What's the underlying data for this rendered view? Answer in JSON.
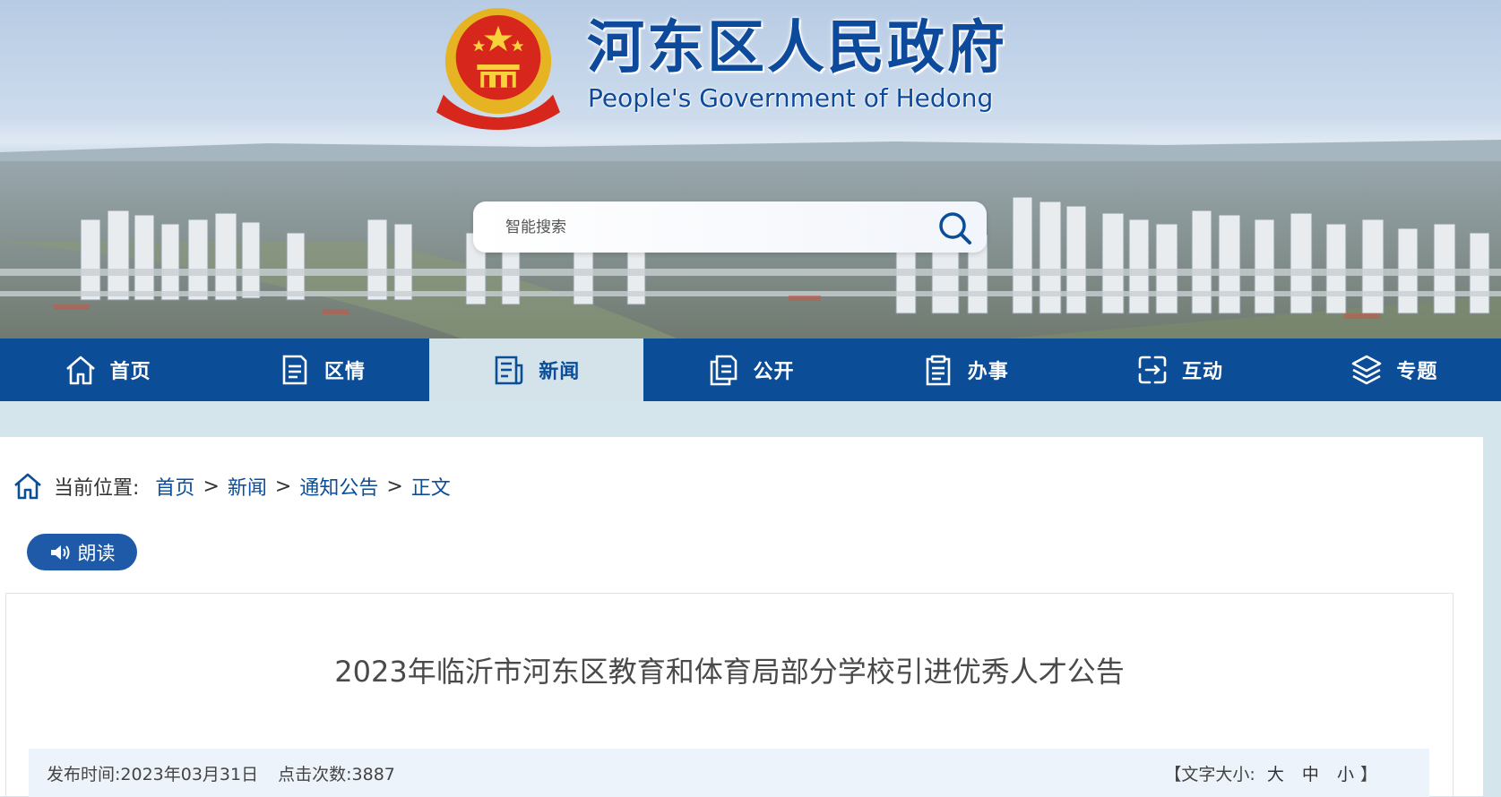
{
  "header": {
    "title": "河东区人民政府",
    "subtitle": "People's Government of Hedong"
  },
  "search": {
    "placeholder": "智能搜索",
    "icon": "search-icon"
  },
  "nav": {
    "items": [
      {
        "label": "首页",
        "icon": "home-icon"
      },
      {
        "label": "区情",
        "icon": "document-icon"
      },
      {
        "label": "新闻",
        "icon": "newspaper-icon",
        "active": true
      },
      {
        "label": "公开",
        "icon": "files-icon"
      },
      {
        "label": "办事",
        "icon": "clipboard-icon"
      },
      {
        "label": "互动",
        "icon": "interaction-icon"
      },
      {
        "label": "专题",
        "icon": "layers-icon"
      }
    ]
  },
  "breadcrumb": {
    "label": "当前位置:",
    "items": [
      "首页",
      "新闻",
      "通知公告",
      "正文"
    ],
    "separator": ">"
  },
  "read_button": {
    "label": "朗读"
  },
  "article": {
    "title": "2023年临沂市河东区教育和体育局部分学校引进优秀人才公告",
    "publish_label": "发布时间:",
    "publish_date": "2023年03月31日",
    "clicks_label": "点击次数:",
    "clicks": "3887",
    "font_size": {
      "open": "【",
      "label": "文字大小:",
      "large": "大",
      "medium": "中",
      "small": "小",
      "close": "】"
    }
  },
  "colors": {
    "primary": "#0b4d97",
    "nav_active_bg": "#d4e3ea",
    "page_bg": "#d5e5ec",
    "meta_bg": "#edf3fa"
  }
}
